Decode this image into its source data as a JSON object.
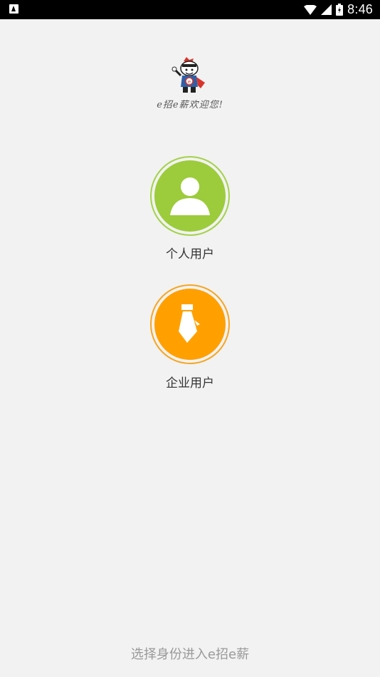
{
  "status_bar": {
    "time": "8:46",
    "icons": [
      "notification-icon",
      "wifi-icon",
      "signal-icon",
      "battery-icon"
    ]
  },
  "header": {
    "welcome_text": "e招e薪欢迎您!",
    "logo": "mascot-logo"
  },
  "roles": {
    "personal": {
      "label": "个人用户",
      "icon": "person-icon",
      "color": "#9ccc3b"
    },
    "enterprise": {
      "label": "企业用户",
      "icon": "tie-icon",
      "color": "#ffa000"
    }
  },
  "footer": {
    "hint": "选择身份进入e招e薪"
  }
}
